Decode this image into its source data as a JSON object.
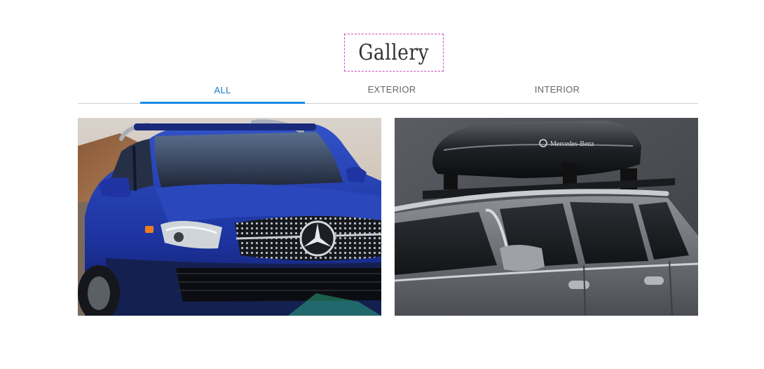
{
  "page_title": "Gallery",
  "tabs": [
    {
      "label": "ALL",
      "active": true
    },
    {
      "label": "EXTERIOR",
      "active": false
    },
    {
      "label": "INTERIOR",
      "active": false
    }
  ],
  "gallery": {
    "items": [
      {
        "category": "exterior",
        "subject": "blue SUV front view"
      },
      {
        "category": "exterior",
        "subject": "silver SUV with roof box"
      }
    ],
    "roof_box_brand": "Mercedes-Benz"
  },
  "colors": {
    "accent": "#1a8ae5",
    "active_tab_text": "#1779c5",
    "inactive_tab_text": "#666666",
    "divider": "#cfcfcf",
    "title_outline": "#c94fc2"
  }
}
